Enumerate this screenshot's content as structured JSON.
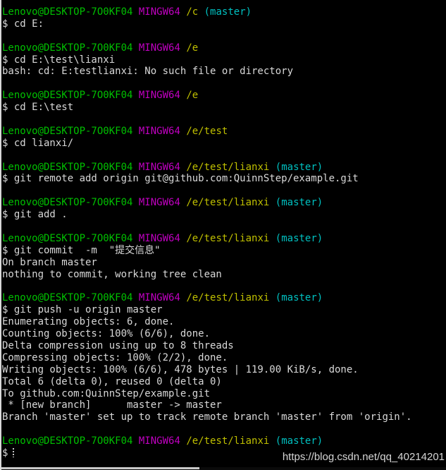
{
  "window": {
    "shell": "MINGW64",
    "background": "#000000",
    "foreground": "#d8d8d8",
    "colors": {
      "user": "#00c000",
      "shell": "#c000c0",
      "path": "#bfbf00",
      "branch": "#00c0c0",
      "text": "#d8d8d8"
    }
  },
  "prompt": {
    "user_host": "Lenovo@DESKTOP-7O0KF04",
    "shell": "MINGW64",
    "dollar": "$"
  },
  "watermark": {
    "text": "https://blog.csdn.net/qq_40214201"
  },
  "lines": [
    {
      "type": "prompt",
      "user_host": "Lenovo@DESKTOP-7O0KF04",
      "shell": "MINGW64",
      "path": "/c",
      "branch": "(master)"
    },
    {
      "type": "command",
      "text": "$ cd E:"
    },
    {
      "type": "blank"
    },
    {
      "type": "prompt",
      "user_host": "Lenovo@DESKTOP-7O0KF04",
      "shell": "MINGW64",
      "path": "/e",
      "branch": ""
    },
    {
      "type": "command",
      "text": "$ cd E:\\test\\lianxi"
    },
    {
      "type": "output",
      "text": "bash: cd: E:testlianxi: No such file or directory"
    },
    {
      "type": "blank"
    },
    {
      "type": "prompt",
      "user_host": "Lenovo@DESKTOP-7O0KF04",
      "shell": "MINGW64",
      "path": "/e",
      "branch": ""
    },
    {
      "type": "command",
      "text": "$ cd E:\\test"
    },
    {
      "type": "blank"
    },
    {
      "type": "prompt",
      "user_host": "Lenovo@DESKTOP-7O0KF04",
      "shell": "MINGW64",
      "path": "/e/test",
      "branch": ""
    },
    {
      "type": "command",
      "text": "$ cd lianxi/"
    },
    {
      "type": "blank"
    },
    {
      "type": "prompt",
      "user_host": "Lenovo@DESKTOP-7O0KF04",
      "shell": "MINGW64",
      "path": "/e/test/lianxi",
      "branch": "(master)"
    },
    {
      "type": "command",
      "text": "$ git remote add origin git@github.com:QuinnStep/example.git"
    },
    {
      "type": "blank"
    },
    {
      "type": "prompt",
      "user_host": "Lenovo@DESKTOP-7O0KF04",
      "shell": "MINGW64",
      "path": "/e/test/lianxi",
      "branch": "(master)"
    },
    {
      "type": "command",
      "text": "$ git add ."
    },
    {
      "type": "blank"
    },
    {
      "type": "prompt",
      "user_host": "Lenovo@DESKTOP-7O0KF04",
      "shell": "MINGW64",
      "path": "/e/test/lianxi",
      "branch": "(master)"
    },
    {
      "type": "command",
      "text": "$ git commit  -m  \"提交信息\""
    },
    {
      "type": "output",
      "text": "On branch master"
    },
    {
      "type": "output",
      "text": "nothing to commit, working tree clean"
    },
    {
      "type": "blank"
    },
    {
      "type": "prompt",
      "user_host": "Lenovo@DESKTOP-7O0KF04",
      "shell": "MINGW64",
      "path": "/e/test/lianxi",
      "branch": "(master)"
    },
    {
      "type": "command",
      "text": "$ git push -u origin master"
    },
    {
      "type": "output",
      "text": "Enumerating objects: 6, done."
    },
    {
      "type": "output",
      "text": "Counting objects: 100% (6/6), done."
    },
    {
      "type": "output",
      "text": "Delta compression using up to 8 threads"
    },
    {
      "type": "output",
      "text": "Compressing objects: 100% (2/2), done."
    },
    {
      "type": "output",
      "text": "Writing objects: 100% (6/6), 478 bytes | 119.00 KiB/s, done."
    },
    {
      "type": "output",
      "text": "Total 6 (delta 0), reused 0 (delta 0)"
    },
    {
      "type": "output",
      "text": "To github.com:QuinnStep/example.git"
    },
    {
      "type": "output",
      "text": " * [new branch]      master -> master"
    },
    {
      "type": "output",
      "text": "Branch 'master' set up to track remote branch 'master' from 'origin'."
    },
    {
      "type": "blank"
    },
    {
      "type": "prompt",
      "user_host": "Lenovo@DESKTOP-7O0KF04",
      "shell": "MINGW64",
      "path": "/e/test/lianxi",
      "branch": "(master)"
    },
    {
      "type": "cursor",
      "text": "$"
    }
  ]
}
